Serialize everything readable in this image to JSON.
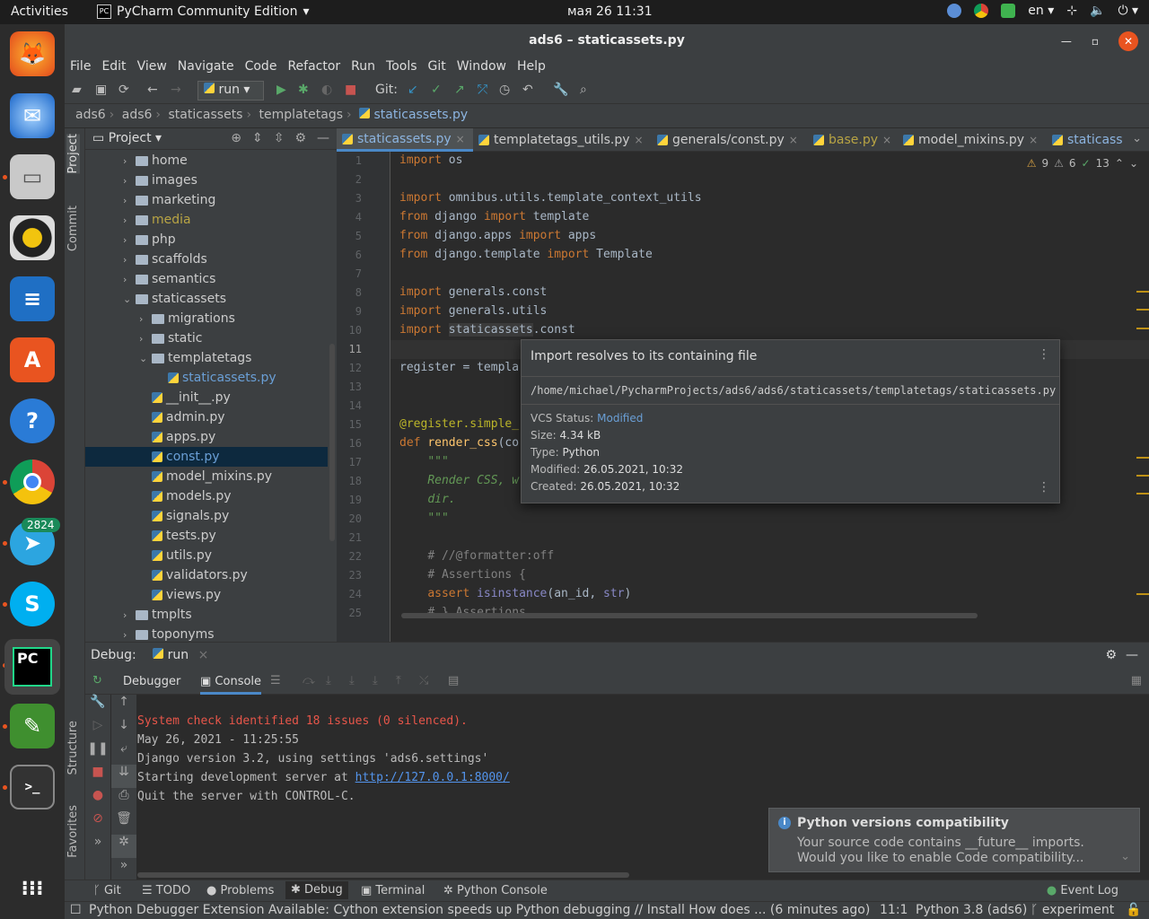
{
  "topbar": {
    "activities": "Activities",
    "app_name": "PyCharm Community Edition",
    "clock": "мая 26  11:31",
    "lang": "en"
  },
  "dock": {
    "telegram_badge": "2824"
  },
  "window": {
    "title": "ads6 – staticassets.py"
  },
  "menu": [
    "File",
    "Edit",
    "View",
    "Navigate",
    "Code",
    "Refactor",
    "Run",
    "Tools",
    "Git",
    "Window",
    "Help"
  ],
  "toolbar": {
    "run_config": "run",
    "git_label": "Git:"
  },
  "breadcrumb": [
    "ads6",
    "ads6",
    "staticassets",
    "templatetags",
    "staticassets.py"
  ],
  "project": {
    "header": "Project",
    "tree": [
      {
        "label": "home",
        "type": "folder",
        "indent": 0,
        "chev": ">"
      },
      {
        "label": "images",
        "type": "folder",
        "indent": 0,
        "chev": ">"
      },
      {
        "label": "marketing",
        "type": "folder",
        "indent": 0,
        "chev": ">"
      },
      {
        "label": "media",
        "type": "folder",
        "indent": 0,
        "chev": ">",
        "color": "#b8a444"
      },
      {
        "label": "php",
        "type": "folder",
        "indent": 0,
        "chev": ">"
      },
      {
        "label": "scaffolds",
        "type": "folder",
        "indent": 0,
        "chev": ">"
      },
      {
        "label": "semantics",
        "type": "folder",
        "indent": 0,
        "chev": ">"
      },
      {
        "label": "staticassets",
        "type": "folder",
        "indent": 0,
        "chev": "v"
      },
      {
        "label": "migrations",
        "type": "folder",
        "indent": 1,
        "chev": ">"
      },
      {
        "label": "static",
        "type": "folder",
        "indent": 1,
        "chev": ">"
      },
      {
        "label": "templatetags",
        "type": "folder",
        "indent": 1,
        "chev": "v"
      },
      {
        "label": "staticassets.py",
        "type": "py",
        "indent": 2,
        "chev": "",
        "color": "#6a9fd6"
      },
      {
        "label": "__init__.py",
        "type": "py",
        "indent": 1,
        "chev": ""
      },
      {
        "label": "admin.py",
        "type": "py",
        "indent": 1,
        "chev": ""
      },
      {
        "label": "apps.py",
        "type": "py",
        "indent": 1,
        "chev": ""
      },
      {
        "label": "const.py",
        "type": "py",
        "indent": 1,
        "chev": "",
        "selected": true,
        "color": "#6a9fd6"
      },
      {
        "label": "model_mixins.py",
        "type": "py",
        "indent": 1,
        "chev": ""
      },
      {
        "label": "models.py",
        "type": "py",
        "indent": 1,
        "chev": ""
      },
      {
        "label": "signals.py",
        "type": "py",
        "indent": 1,
        "chev": ""
      },
      {
        "label": "tests.py",
        "type": "py",
        "indent": 1,
        "chev": ""
      },
      {
        "label": "utils.py",
        "type": "py",
        "indent": 1,
        "chev": ""
      },
      {
        "label": "validators.py",
        "type": "py",
        "indent": 1,
        "chev": ""
      },
      {
        "label": "views.py",
        "type": "py",
        "indent": 1,
        "chev": ""
      },
      {
        "label": "tmplts",
        "type": "folder",
        "indent": 0,
        "chev": ">"
      },
      {
        "label": "toponyms",
        "type": "folder",
        "indent": 0,
        "chev": ">"
      }
    ]
  },
  "tabs": [
    {
      "label": "staticassets.py",
      "active": true,
      "color": "#8cb4e0",
      "closable": true
    },
    {
      "label": "templatetags_utils.py",
      "active": false,
      "color": "#ccc",
      "closable": true
    },
    {
      "label": "generals/const.py",
      "active": false,
      "color": "#ccc",
      "closable": true
    },
    {
      "label": "base.py",
      "active": false,
      "color": "#b8a444",
      "closable": true
    },
    {
      "label": "model_mixins.py",
      "active": false,
      "color": "#ccc",
      "closable": true
    },
    {
      "label": "staticass",
      "active": false,
      "color": "#8cb4e0",
      "closable": false
    }
  ],
  "inspections": {
    "warnings": "9",
    "weak": "6",
    "typos": "13"
  },
  "code": {
    "line_numbers": [
      "1",
      "2",
      "3",
      "4",
      "5",
      "6",
      "7",
      "8",
      "9",
      "10",
      "11",
      "12",
      "13",
      "14",
      "15",
      "16",
      "17",
      "18",
      "19",
      "20",
      "21",
      "22",
      "23",
      "24",
      "25"
    ]
  },
  "popup": {
    "title": "Import resolves to its containing file",
    "path": "/home/michael/PycharmProjects/ads6/ads6/staticassets/templatetags/staticassets.py",
    "vcs_label": "VCS Status:",
    "vcs_value": "Modified",
    "size_label": "Size:",
    "size_value": "4.34 kB",
    "type_label": "Type:",
    "type_value": "Python",
    "modified_label": "Modified:",
    "modified_value": "26.05.2021, 10:32",
    "created_label": "Created:",
    "created_value": "26.05.2021, 10:32"
  },
  "debug": {
    "label": "Debug:",
    "config": "run",
    "tab_debugger": "Debugger",
    "tab_console": "Console",
    "console": [
      {
        "text": "System check identified 18 issues (0 silenced).",
        "err": true
      },
      {
        "text": "May 26, 2021 - 11:25:55",
        "err": false
      },
      {
        "text": "Django version 3.2, using settings 'ads6.settings'",
        "err": false
      },
      {
        "text": "Starting development server at ",
        "err": false,
        "link": "http://127.0.0.1:8000/"
      },
      {
        "text": "Quit the server with CONTROL-C.",
        "err": false
      }
    ]
  },
  "notification": {
    "title": "Python versions compatibility",
    "line1": "Your source code contains __future__ imports.",
    "line2": "Would you like to enable Code compatibility..."
  },
  "side_labels": {
    "project": "Project",
    "commit": "Commit",
    "structure": "Structure",
    "favorites": "Favorites"
  },
  "bottom_tabs": [
    "Git",
    "TODO",
    "Problems",
    "Debug",
    "Terminal",
    "Python Console"
  ],
  "event_log": "Event Log",
  "status": {
    "message": "Python Debugger Extension Available: Cython extension speeds up Python debugging // Install  How does ... (6 minutes ago)",
    "position": "11:1",
    "interpreter": "Python 3.8 (ads6)",
    "branch": "experiment"
  }
}
